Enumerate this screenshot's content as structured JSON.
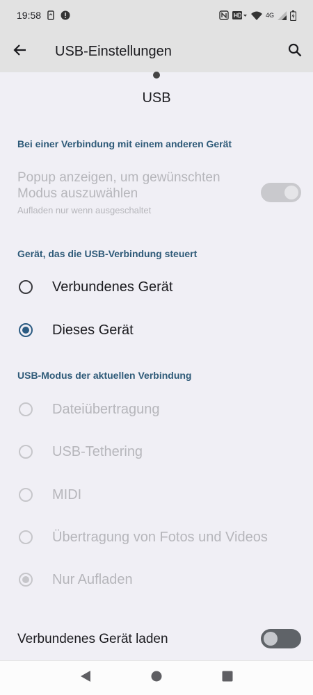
{
  "status_bar": {
    "time": "19:58",
    "network_label": "4G",
    "icons": [
      "phone-sync-icon",
      "alert-icon",
      "nfc-icon",
      "hd-icon",
      "wifi-icon",
      "signal-icon",
      "battery-icon"
    ]
  },
  "app_bar": {
    "title": "USB-Einstellungen",
    "back_icon": "arrow-back-icon",
    "search_icon": "search-icon"
  },
  "heading": "USB",
  "sections": {
    "connection": {
      "title": "Bei einer Verbindung mit einem anderen Gerät",
      "popup_title": "Popup anzeigen, um gewünschten Modus auszuwählen",
      "popup_summary": "Aufladen nur wenn ausgeschaltet",
      "popup_switch_on": true
    },
    "controller": {
      "title": "Gerät, das die USB-Verbindung steuert",
      "options": [
        {
          "label": "Verbundenes Gerät",
          "checked": false
        },
        {
          "label": "Dieses Gerät",
          "checked": true
        }
      ]
    },
    "mode": {
      "title": "USB-Modus der aktuellen Verbindung",
      "options": [
        {
          "label": "Dateiübertragung",
          "checked": false
        },
        {
          "label": "USB-Tethering",
          "checked": false
        },
        {
          "label": "MIDI",
          "checked": false
        },
        {
          "label": "Übertragung von Fotos und Videos",
          "checked": false
        },
        {
          "label": "Nur Aufladen",
          "checked": true
        }
      ]
    },
    "charge": {
      "title": "Verbundenes Gerät laden",
      "switch_on": false
    }
  },
  "colors": {
    "accent": "#2b5b82",
    "section_title": "#2e5a78",
    "background": "#f0eff5",
    "app_bar": "#e2e2e2",
    "disabled_text": "#b6b6bb"
  }
}
